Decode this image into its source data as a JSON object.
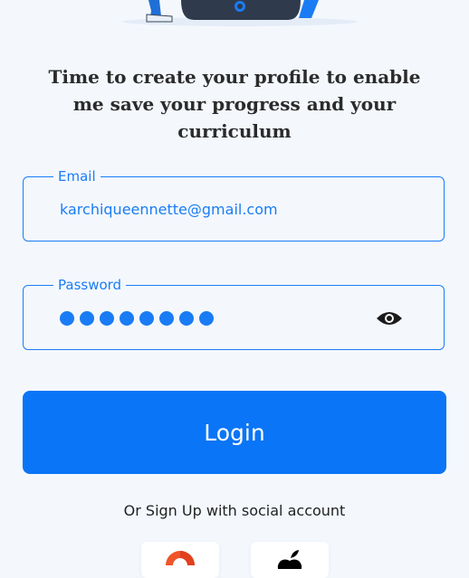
{
  "headline": "Time to create your profile to enable me save your progress and your curriculum",
  "email": {
    "label": "Email",
    "value": "karchiqueennette@gmail.com"
  },
  "password": {
    "label": "Password",
    "masked_length": 8,
    "toggle_icon": "eye-icon"
  },
  "login_label": "Login",
  "social_caption": "Or Sign Up with social account",
  "social_buttons": [
    {
      "icon": "google-icon"
    },
    {
      "icon": "apple-icon"
    }
  ],
  "colors": {
    "accent": "#1a7cf5",
    "button": "#0a75f6",
    "background": "#f4f8fd"
  }
}
